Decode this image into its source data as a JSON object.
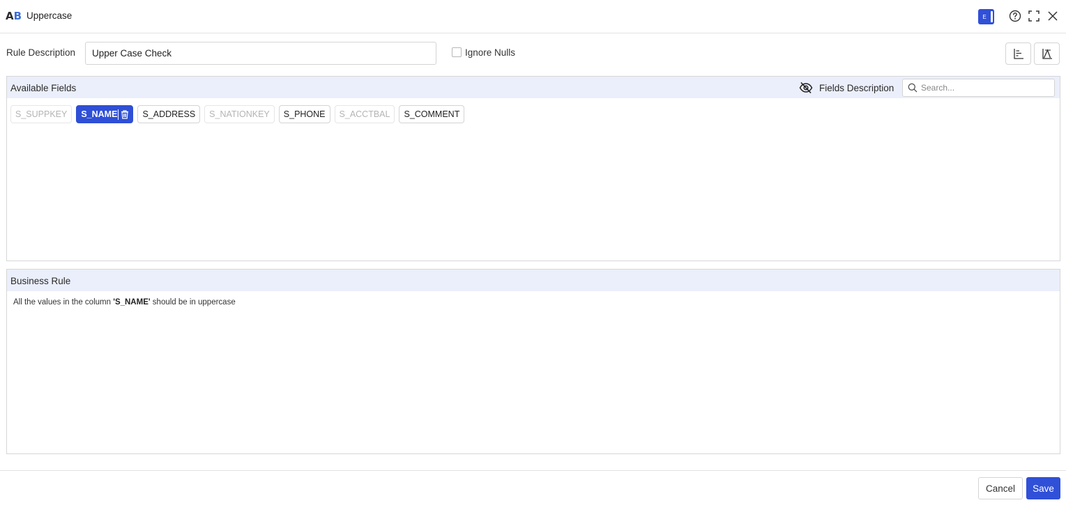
{
  "header": {
    "logo_a": "A",
    "logo_b": "B",
    "title": "Uppercase",
    "badge_letter": "E"
  },
  "rule": {
    "description_label": "Rule Description",
    "description_value": "Upper Case Check",
    "ignore_nulls_label": "Ignore Nulls"
  },
  "available_fields": {
    "title": "Available Fields",
    "fields_description_label": "Fields Description",
    "search_placeholder": "Search...",
    "fields": [
      {
        "label": "S_SUPPKEY",
        "state": "disabled"
      },
      {
        "label": "S_NAME",
        "state": "selected"
      },
      {
        "label": "S_ADDRESS",
        "state": "enabled"
      },
      {
        "label": "S_NATIONKEY",
        "state": "disabled"
      },
      {
        "label": "S_PHONE",
        "state": "enabled"
      },
      {
        "label": "S_ACCTBAL",
        "state": "disabled"
      },
      {
        "label": "S_COMMENT",
        "state": "enabled"
      }
    ]
  },
  "business_rule": {
    "title": "Business Rule",
    "text_prefix": "All the values in the column ",
    "text_column": "'S_NAME'",
    "text_suffix": " should be in uppercase"
  },
  "footer": {
    "cancel_label": "Cancel",
    "save_label": "Save"
  },
  "colors": {
    "accent": "#3050d8",
    "panel_header": "#ebeffb"
  }
}
